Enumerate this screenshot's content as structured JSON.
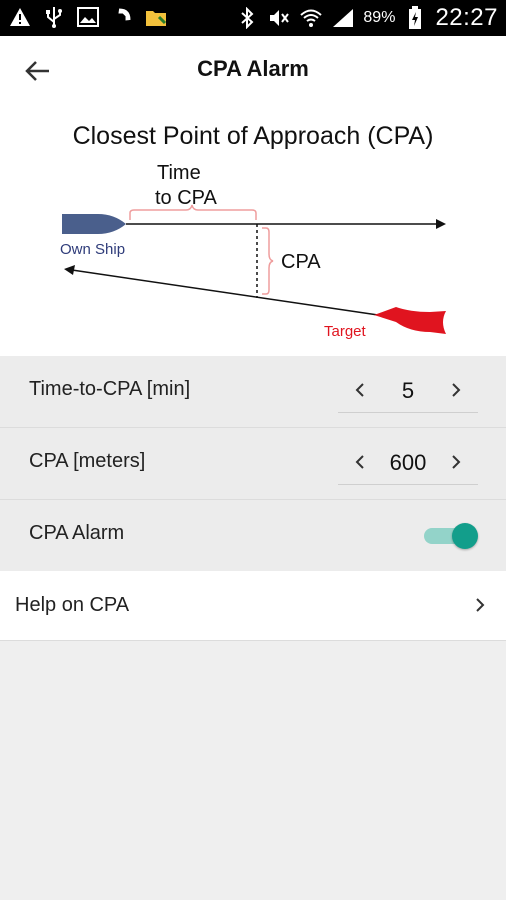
{
  "status_bar": {
    "battery_text": "89%",
    "time": "22:27"
  },
  "appbar": {
    "title": "CPA Alarm"
  },
  "diagram": {
    "title": "Closest Point of Approach (CPA)",
    "time_label_line1": "Time",
    "time_label_line2": "to CPA",
    "cpa_label": "CPA",
    "own_ship_label": "Own Ship",
    "target_label": "Target",
    "own_ship_color": "#4a5f8c",
    "target_color": "#e0141f"
  },
  "settings": {
    "time_to_cpa": {
      "label": "Time-to-CPA [min]",
      "value": "5"
    },
    "cpa_meters": {
      "label": "CPA [meters]",
      "value": "600"
    },
    "cpa_alarm": {
      "label": "CPA Alarm",
      "enabled": true
    }
  },
  "help": {
    "label": "Help on CPA"
  },
  "colors": {
    "accent": "#129e8b",
    "accent_track": "#93d3c9"
  }
}
